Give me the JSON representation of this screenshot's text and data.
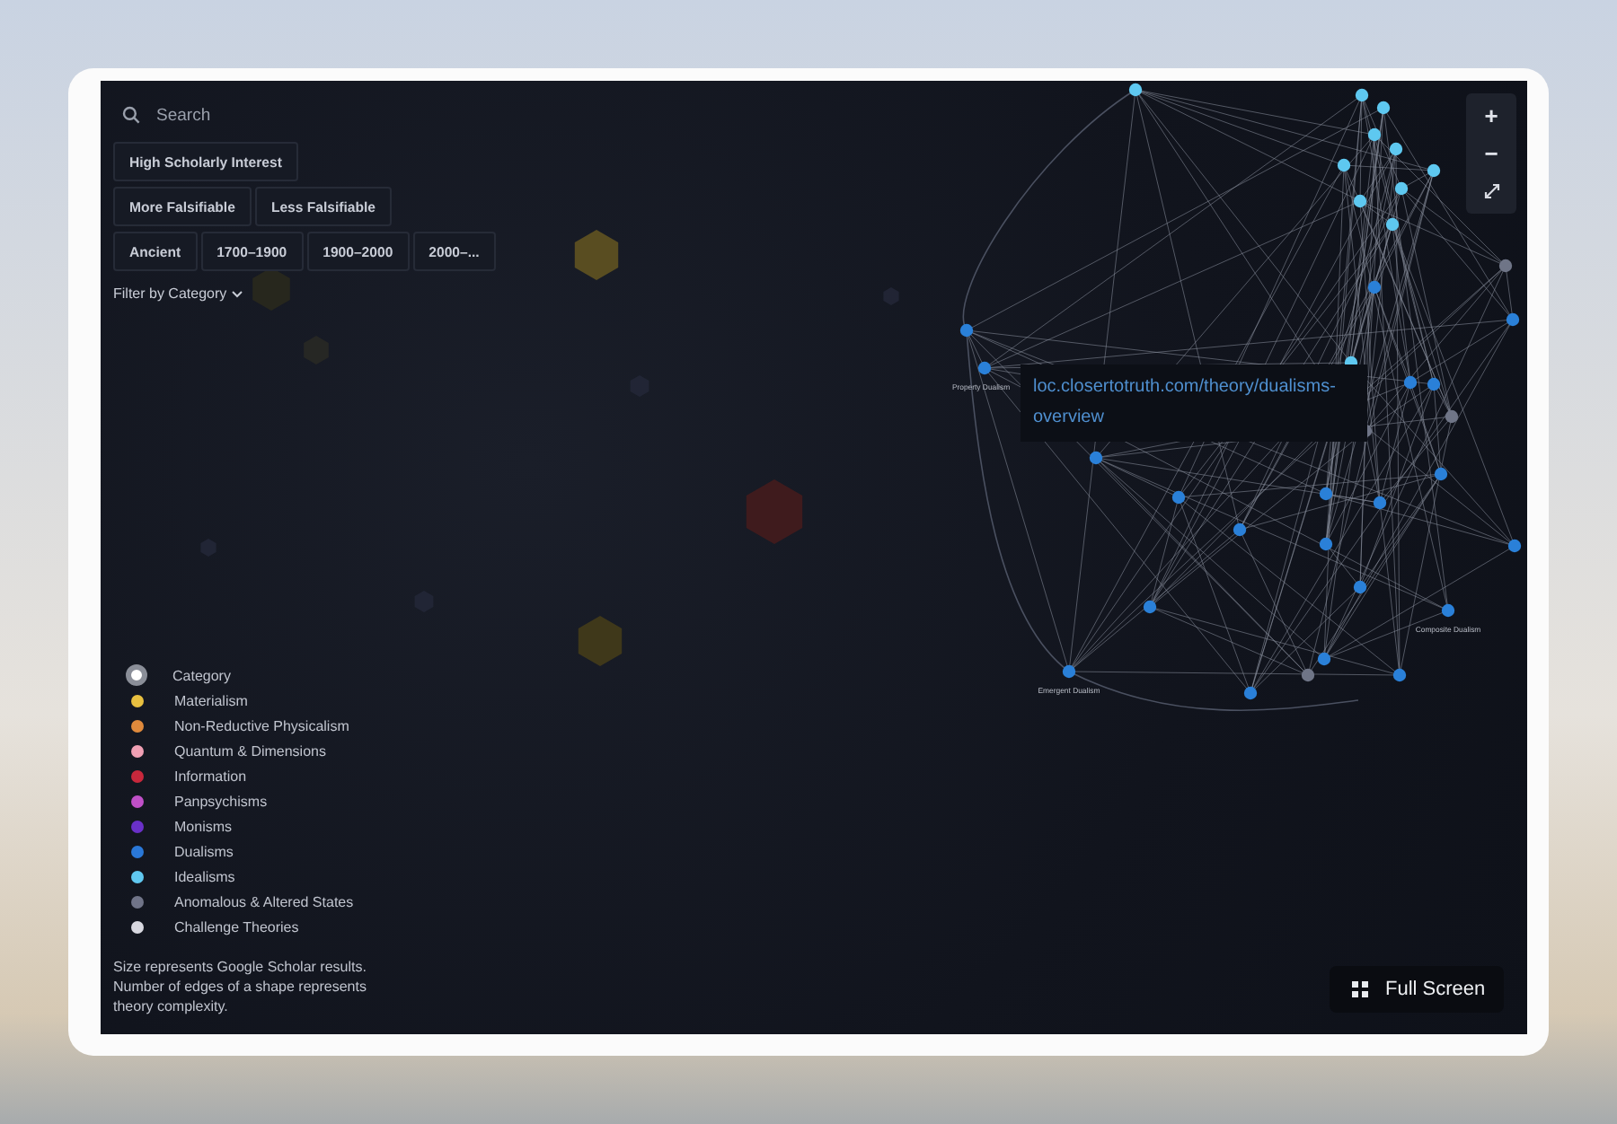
{
  "search": {
    "placeholder": "Search"
  },
  "filters": [
    [
      {
        "label": "High Scholarly Interest",
        "selected": false
      }
    ],
    [
      {
        "label": "More Falsifiable",
        "selected": false
      },
      {
        "label": "Less Falsifiable",
        "selected": false
      }
    ],
    [
      {
        "label": "Ancient",
        "selected": false
      },
      {
        "label": "1700–1900",
        "selected": false
      },
      {
        "label": "1900–2000",
        "selected": false
      },
      {
        "label": "2000–...",
        "selected": false
      }
    ]
  ],
  "category_filter": {
    "label": "Filter by Category"
  },
  "graph": {
    "node_labels": [
      "Property Dualism",
      "Emergent Dualism",
      "Composite Dualism"
    ]
  },
  "tooltip": {
    "url": "loc.closertotruth.com/theory/dualisms-overview"
  },
  "zoom_controls": [
    "+",
    "−"
  ],
  "legend": {
    "items": [
      {
        "kind": "header",
        "label": "Category"
      },
      {
        "kind": "category",
        "label": "Materialism",
        "color": "#e8c040"
      },
      {
        "kind": "category",
        "label": "Non-Reductive Physicalism",
        "color": "#e08a3c"
      },
      {
        "kind": "category",
        "label": "Quantum & Dimensions",
        "color": "#f0a0b4"
      },
      {
        "kind": "category",
        "label": "Information",
        "color": "#c8283c"
      },
      {
        "kind": "category",
        "label": "Panpsychisms",
        "color": "#c050c8"
      },
      {
        "kind": "category",
        "label": "Monisms",
        "color": "#6a30c8"
      },
      {
        "kind": "category",
        "label": "Dualisms",
        "color": "#2a78d8"
      },
      {
        "kind": "category",
        "label": "Idealisms",
        "color": "#60c8f0"
      },
      {
        "kind": "category",
        "label": "Anomalous & Altered States",
        "color": "#707488"
      },
      {
        "kind": "category",
        "label": "Challenge Theories",
        "color": "#d8d8e0"
      }
    ],
    "note": "Size represents Google Scholar results. Number of edges of a shape represents theory complexity."
  },
  "full_screen": {
    "label": "Full Screen"
  }
}
